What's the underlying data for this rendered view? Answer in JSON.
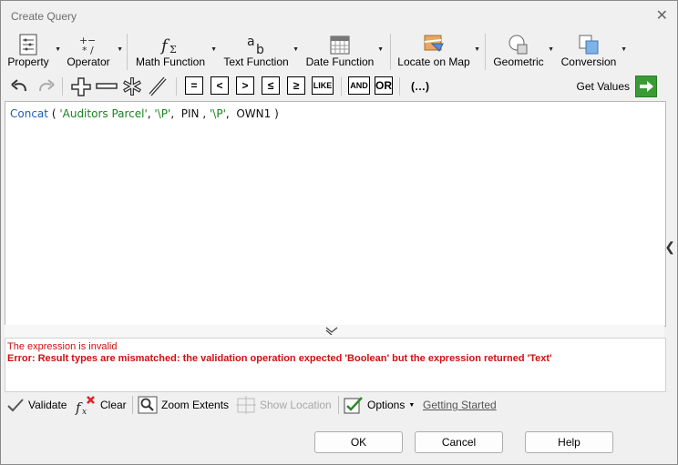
{
  "window": {
    "title": "Create Query",
    "close_glyph": "✕"
  },
  "ribbon": [
    {
      "label": "Property",
      "icon": "property-list-icon"
    },
    {
      "label": "Operator",
      "icon": "operator-icon"
    },
    {
      "label": "Math Function",
      "icon": "math-function-icon"
    },
    {
      "label": "Text Function",
      "icon": "text-function-icon"
    },
    {
      "label": "Date Function",
      "icon": "calendar-icon"
    },
    {
      "label": "Locate on Map",
      "icon": "map-locate-icon"
    },
    {
      "label": "Geometric",
      "icon": "geometric-icon"
    },
    {
      "label": "Conversion",
      "icon": "conversion-icon"
    }
  ],
  "operators": [
    "=",
    "<",
    ">",
    "≤",
    "≥",
    "LIKE",
    "AND",
    "OR",
    "(…)"
  ],
  "get_values": "Get Values",
  "expression": {
    "func": "Concat",
    "open": "(",
    "arg1": "'Auditors Parcel'",
    "arg2": "'\\P'",
    "arg3": "PIN",
    "arg4": "'\\P'",
    "arg5": "OWN1",
    "close": ")"
  },
  "messages": {
    "status": "The expression is invalid",
    "error": "Error: Result types are mismatched: the validation operation expected 'Boolean' but the expression returned 'Text'"
  },
  "bottom": {
    "validate": "Validate",
    "clear": "Clear",
    "zoom_extents": "Zoom Extents",
    "show_location": "Show Location",
    "options": "Options",
    "getting_started": "Getting Started"
  },
  "buttons": {
    "ok": "OK",
    "cancel": "Cancel",
    "help": "Help"
  },
  "colors": {
    "keyword": "#1d5fb5",
    "string": "#19821e",
    "error": "#d01010",
    "get_values_green": "#3a9b35"
  }
}
